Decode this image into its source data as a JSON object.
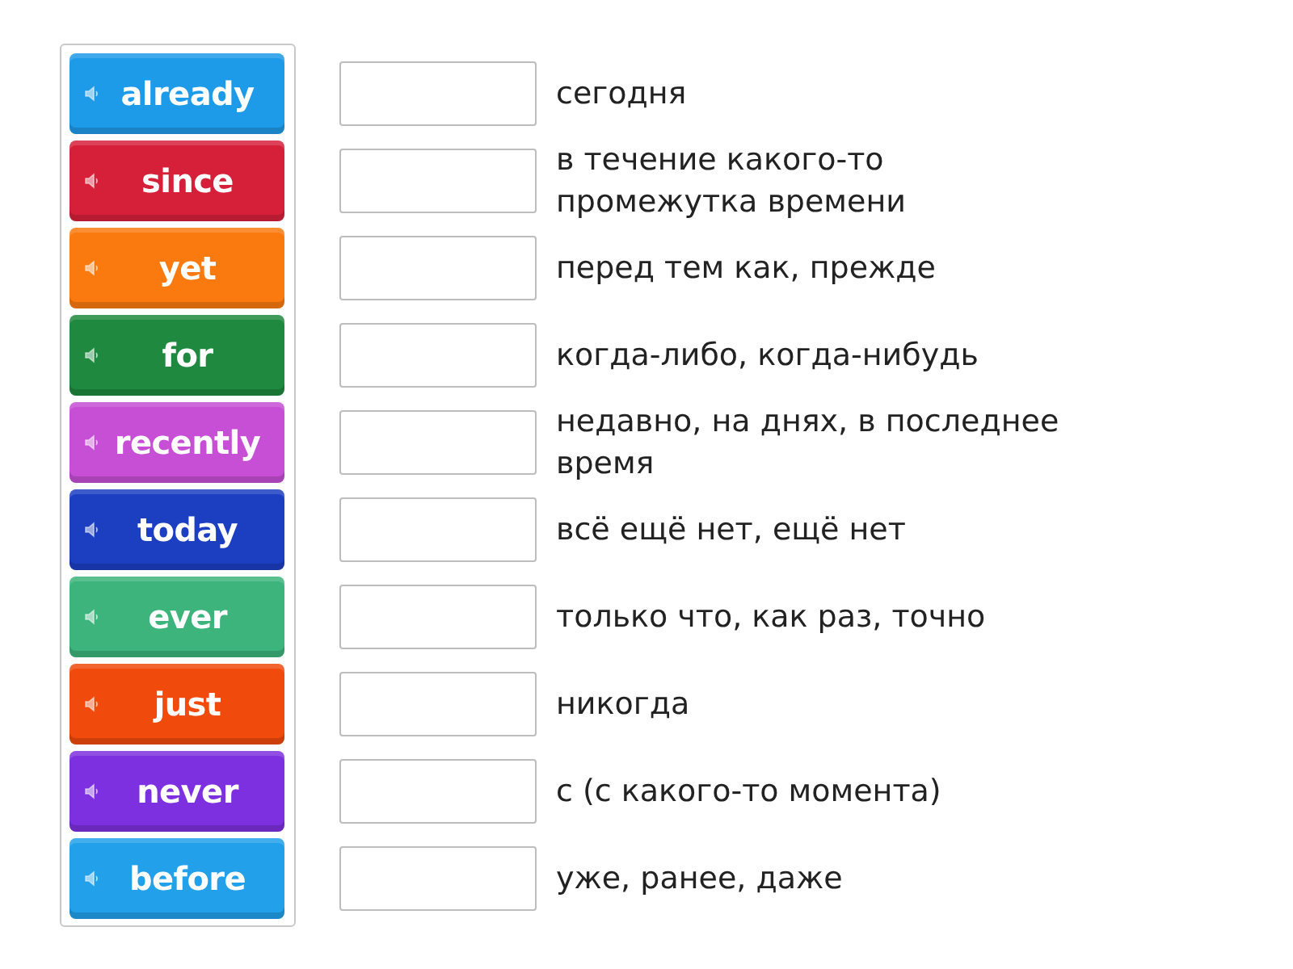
{
  "tiles": [
    {
      "word": "already",
      "color": "#1e9be8"
    },
    {
      "word": "since",
      "color": "#d6203a"
    },
    {
      "word": "yet",
      "color": "#fb7a10"
    },
    {
      "word": "for",
      "color": "#1f8a3f"
    },
    {
      "word": "recently",
      "color": "#c64fd6"
    },
    {
      "word": "today",
      "color": "#1c3fc2"
    },
    {
      "word": "ever",
      "color": "#3cb47c"
    },
    {
      "word": "just",
      "color": "#f04a0c"
    },
    {
      "word": "never",
      "color": "#7d30df"
    },
    {
      "word": "before",
      "color": "#22a0ea"
    }
  ],
  "definitions": [
    "сегодня",
    "в течение какого-то промежутка времени",
    "перед тем как, прежде",
    "когда-либо, когда-нибудь",
    "недавно, на днях, в последнее время",
    "всё ещё нет, ещё нет",
    "только что, как раз, точно",
    "никогда",
    "с (с какого-то момента)",
    "уже, ранее, даже"
  ]
}
